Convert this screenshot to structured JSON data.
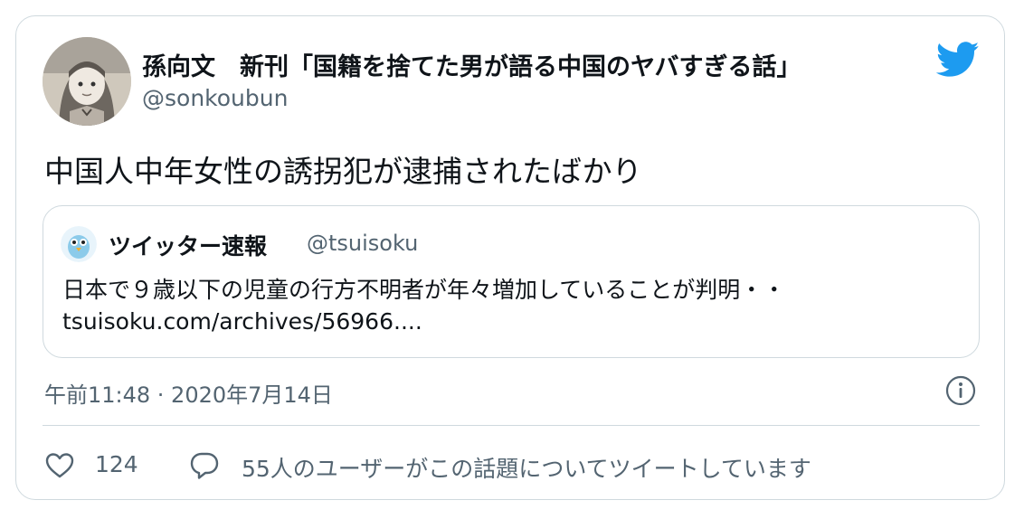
{
  "tweet": {
    "author": {
      "display_name": "孫向文　新刊「国籍を捨てた男が語る中国のヤバすぎる話」",
      "handle": "@sonkoubun"
    },
    "text": "中国人中年女性の誘拐犯が逮捕されたばかり",
    "quoted": {
      "display_name": "ツイッター速報",
      "handle": "@tsuisoku",
      "text": "日本で９歳以下の児童の行方不明者が年々増加していることが判明・・",
      "link": "tsuisoku.com/archives/56966...."
    },
    "timestamp": "午前11:48 · 2020年7月14日",
    "likes": "124",
    "discussion": "55人のユーザーがこの話題についてツイートしています"
  },
  "icons": {
    "brand": "twitter-bird-icon",
    "info": "info-icon",
    "like": "heart-icon",
    "reply": "reply-bubble-icon"
  },
  "colors": {
    "twitter_blue": "#1d9bf0",
    "text_primary": "#0f1419",
    "text_secondary": "#536471",
    "border": "#cfd9de"
  }
}
